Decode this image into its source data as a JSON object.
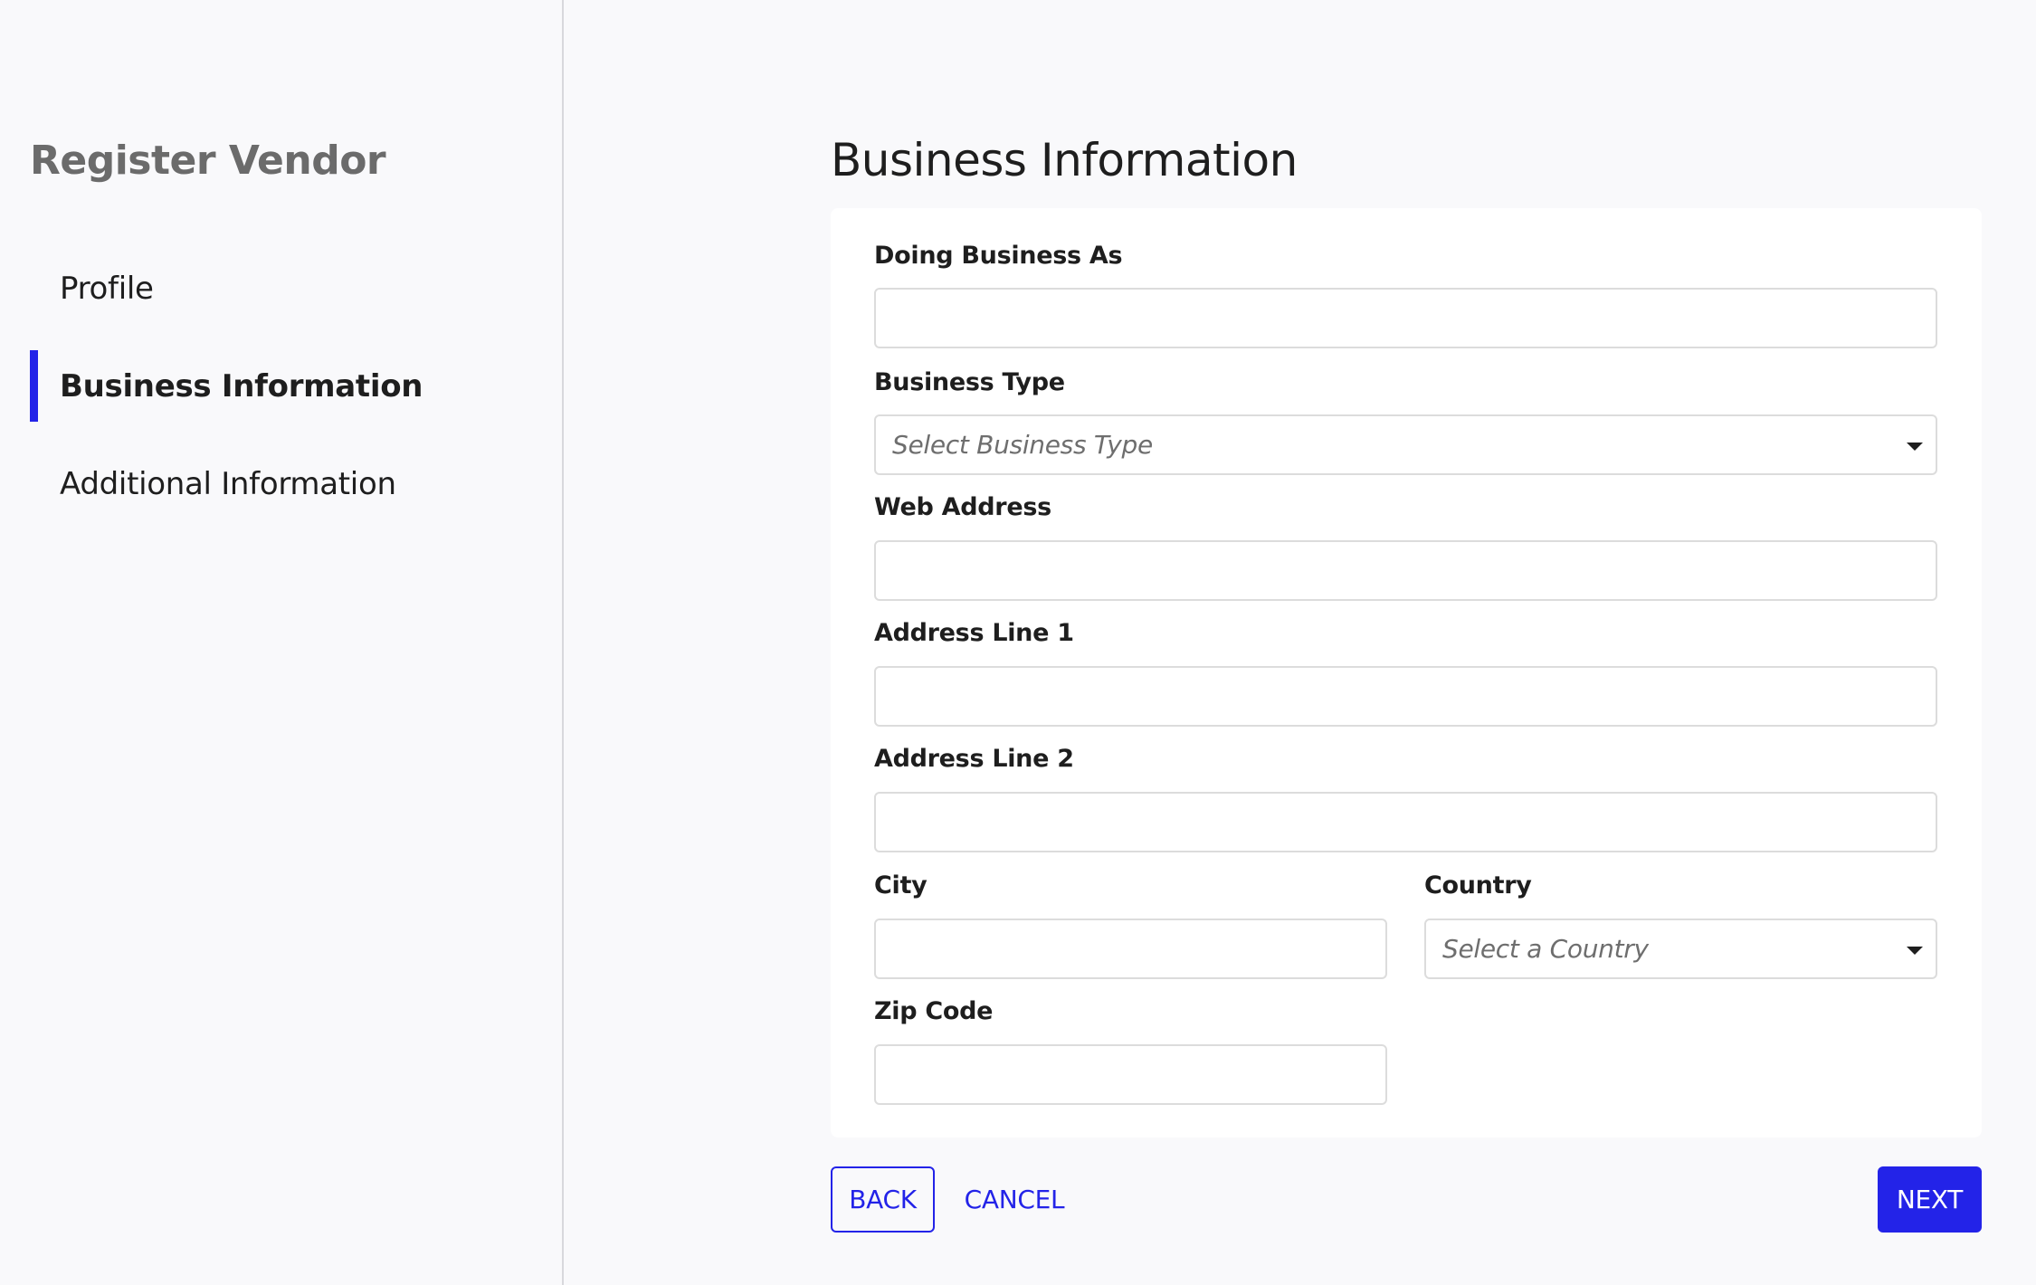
{
  "sidebar": {
    "title": "Register Vendor",
    "items": [
      {
        "label": "Profile",
        "active": false
      },
      {
        "label": "Business Information",
        "active": true
      },
      {
        "label": "Additional Information",
        "active": false
      }
    ]
  },
  "main": {
    "title": "Business Information",
    "fields": {
      "doing_business_as": {
        "label": "Doing Business As",
        "value": "",
        "placeholder": ""
      },
      "business_type": {
        "label": "Business Type",
        "placeholder": "Select Business Type"
      },
      "web_address": {
        "label": "Web Address",
        "value": "",
        "placeholder": ""
      },
      "address_line_1": {
        "label": "Address Line 1",
        "value": "",
        "placeholder": ""
      },
      "address_line_2": {
        "label": "Address Line 2",
        "value": "",
        "placeholder": ""
      },
      "city": {
        "label": "City",
        "value": "",
        "placeholder": ""
      },
      "country": {
        "label": "Country",
        "placeholder": "Select a Country"
      },
      "zip_code": {
        "label": "Zip Code",
        "value": "",
        "placeholder": ""
      }
    }
  },
  "actions": {
    "back_label": "BACK",
    "cancel_label": "CANCEL",
    "next_label": "NEXT"
  },
  "colors": {
    "accent": "#2323e8",
    "background": "#f9f9fb",
    "card": "#ffffff",
    "input_border": "#dcdcdc"
  }
}
